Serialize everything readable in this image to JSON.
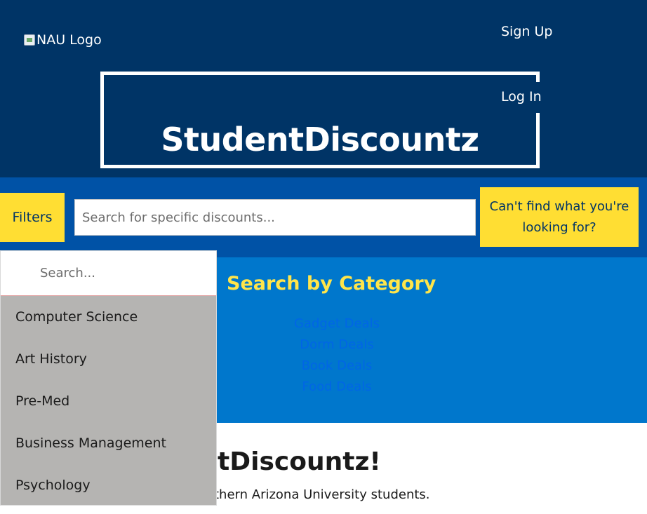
{
  "header": {
    "logo_alt": "NAU Logo",
    "sign_up": "Sign Up",
    "log_in": "Log In",
    "site_title": "StudentDiscountz"
  },
  "searchbar": {
    "filters_label": "Filters",
    "search_placeholder": "Search for specific discounts...",
    "cant_find_label": "Can't find what you're looking for?"
  },
  "category": {
    "heading": "Search by Category",
    "links": [
      "Gadget Deals",
      "Dorm Deals",
      "Book Deals",
      "Food Deals"
    ]
  },
  "welcome": {
    "heading_visible": "entDiscountz!",
    "text_visible": "r Northern Arizona University students."
  },
  "dropdown": {
    "search_placeholder": "Search...",
    "items": [
      "Computer Science",
      "Art History",
      "Pre-Med",
      "Business Management",
      "Psychology"
    ]
  },
  "colors": {
    "header_bg": "#003466",
    "searchbar_bg": "#0052a6",
    "category_bg": "#0077cc",
    "accent_yellow": "#ffde33",
    "dropdown_bg": "#b5b4b2"
  },
  "icons": {
    "logo": "broken-image-icon"
  }
}
